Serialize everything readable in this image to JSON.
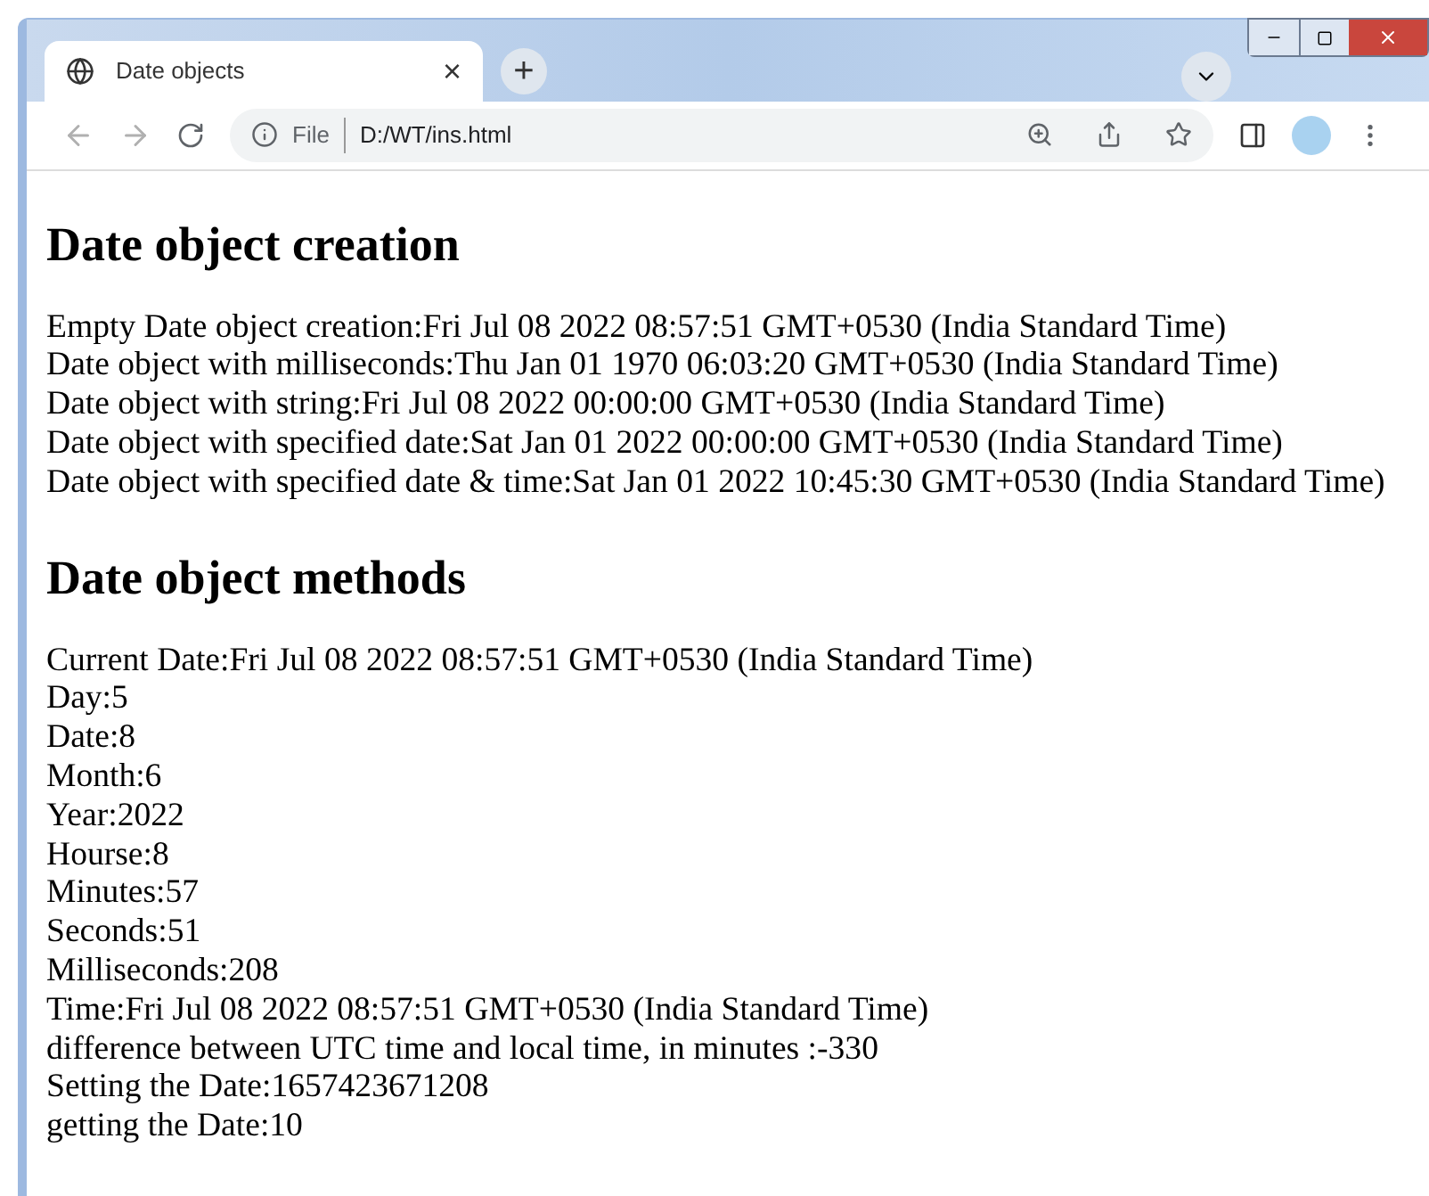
{
  "tab": {
    "title": "Date objects",
    "close": "×",
    "new_tab": "+"
  },
  "address_bar": {
    "scheme": "File",
    "url": "D:/WT/ins.html"
  },
  "sections": [
    {
      "heading": "Date object creation",
      "lines": [
        "Empty Date object creation:Fri Jul 08 2022 08:57:51 GMT+0530 (India Standard Time)",
        "Date object with milliseconds:Thu Jan 01 1970 06:03:20 GMT+0530 (India Standard Time)",
        "Date object with string:Fri Jul 08 2022 00:00:00 GMT+0530 (India Standard Time)",
        "Date object with specified date:Sat Jan 01 2022 00:00:00 GMT+0530 (India Standard Time)",
        "Date object with specified date & time:Sat Jan 01 2022 10:45:30 GMT+0530 (India Standard Time)"
      ]
    },
    {
      "heading": "Date object methods",
      "lines": [
        "Current Date:Fri Jul 08 2022 08:57:51 GMT+0530 (India Standard Time)",
        "Day:5",
        "Date:8",
        "Month:6",
        "Year:2022",
        "Hourse:8",
        "Minutes:57",
        "Seconds:51",
        "Milliseconds:208",
        "Time:Fri Jul 08 2022 08:57:51 GMT+0530 (India Standard Time)",
        "difference between UTC time and local time, in minutes :-330",
        "Setting the Date:1657423671208",
        "getting the Date:10"
      ]
    }
  ]
}
